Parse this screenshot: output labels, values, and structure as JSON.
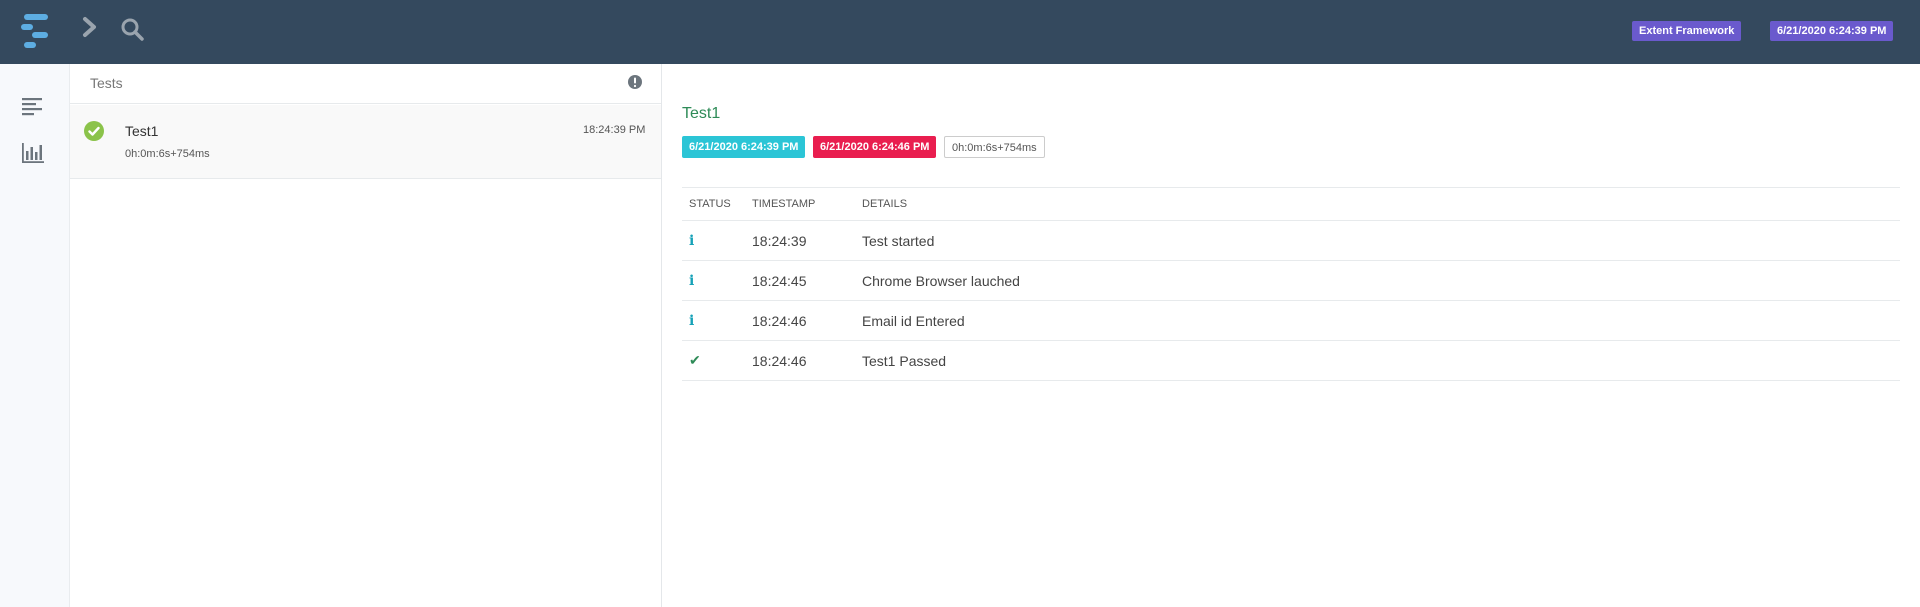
{
  "header": {
    "logo_icon": "extent-logo-icon",
    "nav_icon": "chevron-right-icon",
    "search_icon": "search-icon",
    "framework_badge": "Extent Framework",
    "date_badge": "6/21/2020 6:24:39 PM"
  },
  "sidenav": {
    "items": [
      {
        "icon": "align-left-icon",
        "name": "tests"
      },
      {
        "icon": "bar-chart-icon",
        "name": "dashboard"
      }
    ]
  },
  "test_list": {
    "title": "Tests",
    "info_icon": "exclamation-circle-icon",
    "items": [
      {
        "status": "pass",
        "name": "Test1",
        "duration": "0h:0m:6s+754ms",
        "time": "18:24:39 PM"
      }
    ]
  },
  "test_detail": {
    "name": "Test1",
    "start_time": "6/21/2020 6:24:39 PM",
    "end_time": "6/21/2020 6:24:46 PM",
    "duration": "0h:0m:6s+754ms",
    "columns": [
      "STATUS",
      "TIMESTAMP",
      "DETAILS"
    ],
    "logs": [
      {
        "status": "info",
        "timestamp": "18:24:39",
        "details": "Test started"
      },
      {
        "status": "info",
        "timestamp": "18:24:45",
        "details": "Chrome Browser lauched"
      },
      {
        "status": "info",
        "timestamp": "18:24:46",
        "details": "Email id Entered"
      },
      {
        "status": "pass",
        "timestamp": "18:24:46",
        "details": "Test1 Passed"
      }
    ]
  },
  "colors": {
    "topbar": "#34495e",
    "badge": "#6a5acd",
    "pass": "#2e8b57",
    "pass_icon": "#8bc34a",
    "info": "#17a2b8",
    "start_tag": "#2bc5d6",
    "end_tag": "#e91e4f"
  }
}
